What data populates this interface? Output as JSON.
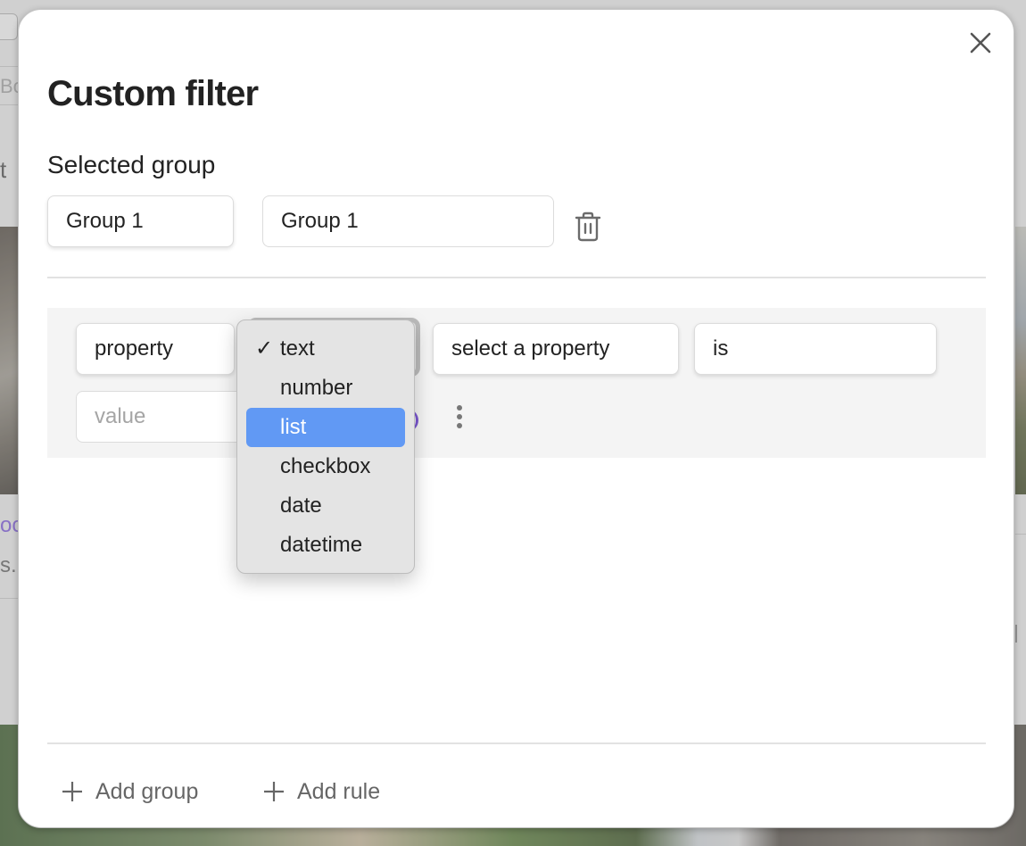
{
  "background": {
    "left_partial_text": "t",
    "left_search_partial": "Bo",
    "left_link_partial": "oc",
    "left_desc_partial": "s."
  },
  "modal": {
    "title": "Custom filter",
    "close_icon": "close-icon",
    "selected_group": {
      "label": "Selected group",
      "group_select_value": "Group 1",
      "group_name_value": "Group 1",
      "delete_icon": "trash-icon"
    },
    "rule": {
      "source_value": "property",
      "type_value": "text",
      "property_value": "select a property",
      "operator_value": "is",
      "value_placeholder": "value",
      "value": "",
      "more_icon": "more-vertical-icon",
      "toggle_color": "#7b57d1"
    },
    "type_dropdown": {
      "open": true,
      "selected": "text",
      "highlighted": "list",
      "highlight_color": "#6199f4",
      "check_glyph": "✓",
      "options": [
        "text",
        "number",
        "list",
        "checkbox",
        "date",
        "datetime"
      ]
    },
    "footer": {
      "add_group_label": "Add group",
      "add_rule_label": "Add rule",
      "plus_icon": "plus-icon"
    }
  }
}
